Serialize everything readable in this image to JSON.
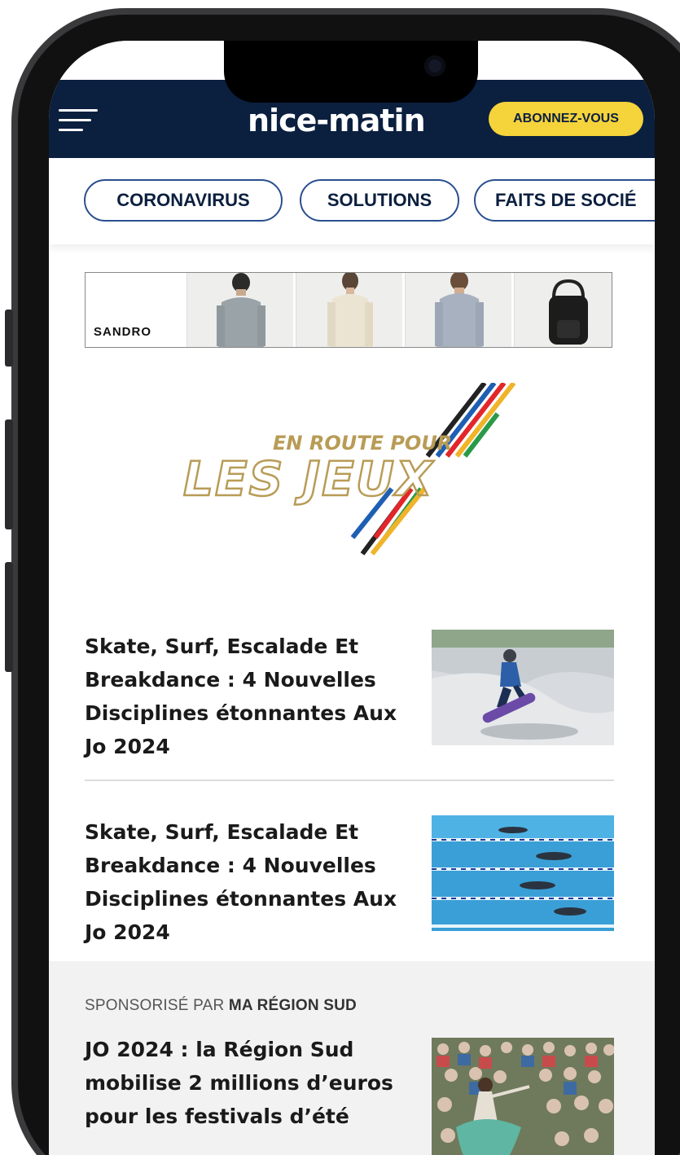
{
  "header": {
    "logo": "nice-matin",
    "subscribe_label": "ABONNEZ-VOUS",
    "background_color": "#0b1f3f",
    "accent_color": "#f5d33b"
  },
  "tabs": [
    {
      "label": "CORONAVIRUS"
    },
    {
      "label": "SOLUTIONS"
    },
    {
      "label": "FAITS DE SOCIÉ"
    }
  ],
  "ad": {
    "brand": "SANDRO"
  },
  "banner": {
    "line1": "EN ROUTE POUR",
    "line2": "LES JEUX"
  },
  "articles": [
    {
      "title": "Skate, Surf, Escalade Et Breakdance : 4 Nouvelles Disciplines étonnantes Aux Jo 2024",
      "image": "skateboarder-photo"
    },
    {
      "title": "Skate, Surf, Escalade Et Breakdance : 4 Nouvelles Disciplines étonnantes Aux Jo 2024",
      "image": "swimming-pool-photo"
    }
  ],
  "sponsored": {
    "label_prefix": "SPONSORISÉ PAR",
    "label_sponsor": "MA RÉGION SUD",
    "title": "JO 2024 : la Région Sud mobilise 2 millions d’euros pour les festivals d’été",
    "image": "festival-crowd-photo"
  }
}
